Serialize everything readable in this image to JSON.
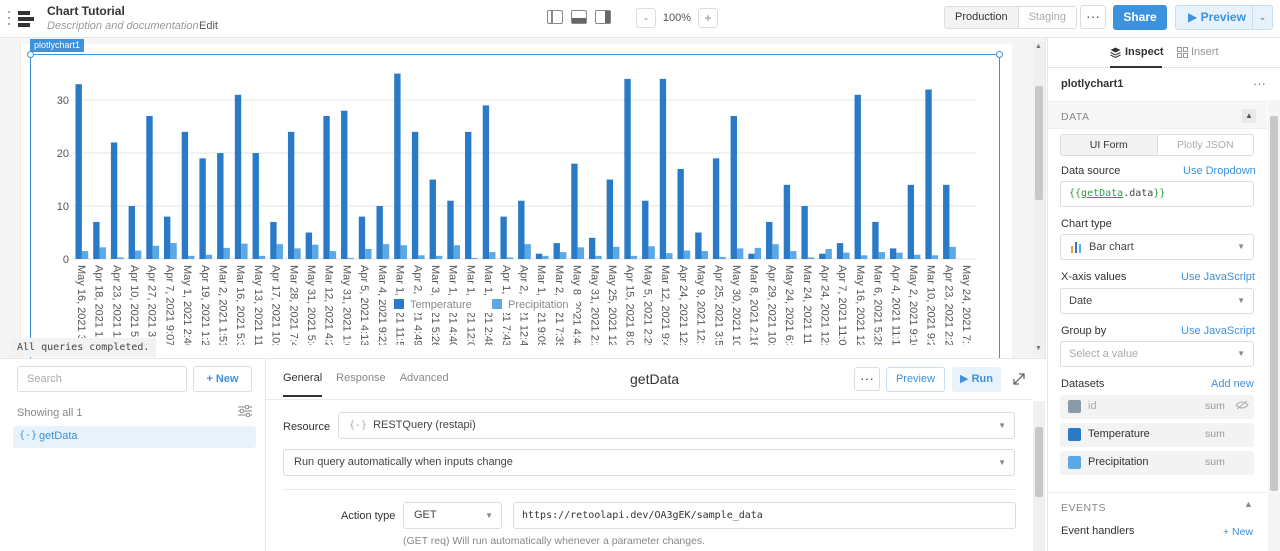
{
  "app": {
    "title": "Chart Tutorial",
    "description": "Description and documentation",
    "edit_label": "Edit"
  },
  "toolbar": {
    "zoom_minus": "-",
    "zoom_value": "100%",
    "zoom_plus": "+",
    "env_production": "Production",
    "env_staging": "Staging",
    "more": "···",
    "share": "Share",
    "preview": "▶ Preview",
    "preview_caret": "⌄"
  },
  "canvas": {
    "component_tag": "plotlychart1",
    "toast": "All queries completed."
  },
  "chart_data": {
    "type": "bar",
    "yticks": [
      0,
      10,
      20,
      30
    ],
    "ylim": [
      0,
      37
    ],
    "legend": [
      "Temperature",
      "Precipitation"
    ],
    "categories": [
      "May 16, 2021 3:",
      "Apr 18, 2021 1:",
      "Apr 23, 2021 12:",
      "Apr 10, 2021 5:",
      "Apr 27, 2021 3:21",
      "Apr 7, 2021 9:07 A",
      "May 1, 2021 2:46 I",
      "Apr 19, 2021 1:25",
      "Mar 2, 2021 1:51 P",
      "Mar 16, 2021 5:33",
      "May 13, 2021 11:4",
      "Apr 17, 2021 10:2",
      "Mar 28, 2021 7:43",
      "May 31, 2021 5:45",
      "Mar 12, 2021 4:20",
      "May 31, 2021 1:08",
      "Apr 5, 2021 4:13 A",
      "Mar 4, 2021 9:21 P",
      "Mar 1, 2021 11:58",
      "Apr 2, 2021 4:49",
      "Mar 3, 2021 5:26",
      "Mar 1, 2021 4:40",
      "Mar 1, 2021 12:0",
      "Mar 1, 2021 2:48",
      "Apr 1, 2021 7:43",
      "Apr 2, 2021 12:4",
      "Mar 1, 2021 9:05",
      "Mar 2, 2021 7:35",
      "May 8, 2021 4:43 A",
      "May 31, 2021 2:23",
      "May 25, 2021 12:2",
      "Apr 15, 2021 8:04",
      "May 5, 2021 2:29 P",
      "Mar 12, 2021 9:42",
      "Apr 24, 2021 12:1",
      "May 9, 2021 12:18",
      "Apr 25, 2021 3:58",
      "May 30, 2021 10:3",
      "Mar 8, 2021 2:16 P",
      "Apr 29, 2021 10:3",
      "May 24, 2021 6:38",
      "Mar 24, 2021 11:2",
      "Apr 24, 2021 12:5",
      "Apr 7, 2021 11:06",
      "May 16, 2021 12:1",
      "Mar 6, 2021 5:28 A",
      "Apr 4, 2021 11:16",
      "May 2, 2021 9:10 A",
      "Mar 10, 2021 9:20",
      "Apr 23, 2021 2:28",
      "May 24, 2021 7:11"
    ],
    "series": [
      {
        "name": "Temperature",
        "color": "#2a7ac7",
        "values": [
          33,
          7,
          22,
          10,
          27,
          8,
          24,
          19,
          20,
          31,
          20,
          7,
          24,
          5,
          27,
          28,
          8,
          10,
          35,
          24,
          15,
          11,
          24,
          29,
          8,
          11,
          1,
          3,
          18,
          4,
          15,
          34,
          11,
          34,
          17,
          5,
          19,
          27,
          1,
          7,
          14,
          10,
          1,
          3,
          31,
          7,
          2,
          14,
          32,
          14,
          0
        ]
      },
      {
        "name": "Precipitation",
        "color": "#5aa9e6",
        "values": [
          1.5,
          2.2,
          0.3,
          1.6,
          2.5,
          3,
          0.6,
          0.8,
          2.1,
          2.9,
          0.6,
          2.8,
          2,
          2.7,
          1.5,
          0.2,
          1.9,
          2.8,
          2.6,
          0.7,
          0.6,
          2.6,
          0.2,
          1.3,
          0.3,
          2.8,
          0.6,
          1.3,
          2.2,
          0.6,
          2.3,
          0.6,
          2.4,
          1.1,
          1.6,
          1.5,
          0.4,
          2,
          2.1,
          2.8,
          1.5,
          0.3,
          1.9,
          1.2,
          0.7,
          1.3,
          1.2,
          0.8,
          0.7,
          2.3,
          0
        ]
      }
    ]
  },
  "queries": {
    "search_placeholder": "Search",
    "new_label": "+ New",
    "showing": "Showing all 1",
    "items": [
      {
        "icon": "{-}",
        "label": "getData"
      }
    ]
  },
  "editor": {
    "tabs": [
      "General",
      "Response",
      "Advanced"
    ],
    "title": "getData",
    "more": "···",
    "preview": "Preview",
    "run": "▶ Run",
    "resource_label": "Resource",
    "resource_value": "RESTQuery (restapi)",
    "resource_icon": "{-}",
    "trigger_value": "Run query automatically when inputs change",
    "action_type_label": "Action type",
    "action_type_value": "GET",
    "url": "https://retoolapi.dev/OA3gEK/sample_data",
    "hint": "(GET req) Will run automatically whenever a parameter changes."
  },
  "inspector": {
    "tab_inspect": "Inspect",
    "tab_insert": "Insert",
    "component": "plotlychart1",
    "dots": "···",
    "section_data": "DATA",
    "seg_ui": "UI Form",
    "seg_json": "Plotly JSON",
    "data_source_label": "Data source",
    "data_source_link": "Use Dropdown",
    "data_source_open": "{{",
    "data_source_var": "getData",
    "data_source_prop": ".data",
    "data_source_close": "}}",
    "chart_type_label": "Chart type",
    "chart_type_value": "Bar chart",
    "x_label": "X-axis values",
    "x_link": "Use JavaScript",
    "x_value": "Date",
    "group_label": "Group by",
    "group_link": "Use JavaScript",
    "group_placeholder": "Select a value",
    "datasets_label": "Datasets",
    "datasets_link": "Add new",
    "datasets": [
      {
        "name": "id",
        "agg": "sum",
        "color": "#8a9aa8"
      },
      {
        "name": "Temperature",
        "agg": "sum",
        "color": "#2a7ac7"
      },
      {
        "name": "Precipitation",
        "agg": "sum",
        "color": "#5aa9e6"
      }
    ],
    "section_events": "EVENTS",
    "event_handlers_label": "Event handlers",
    "event_handlers_link": "+ New"
  }
}
